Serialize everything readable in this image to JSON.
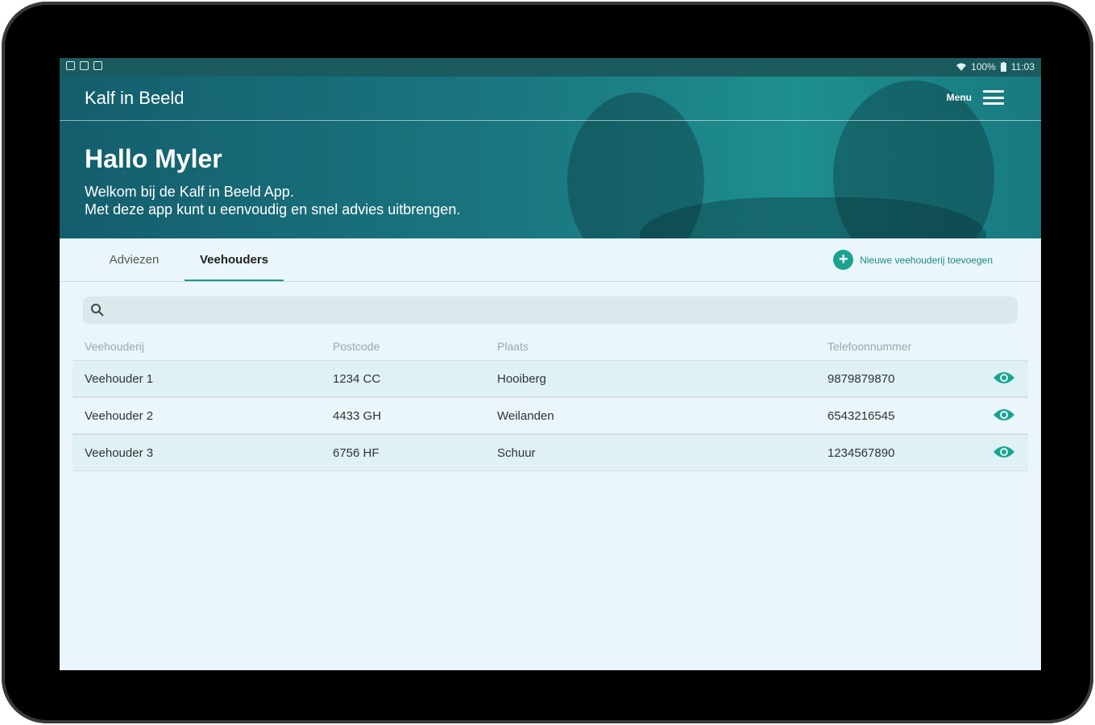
{
  "status_bar": {
    "battery": "100%",
    "time": "11:03",
    "icons": [
      "notification-icon",
      "gallery-icon",
      "clipboard-icon",
      "wifi-icon",
      "battery-icon"
    ]
  },
  "app": {
    "title": "Kalf in Beeld",
    "menu_label": "Menu"
  },
  "hero": {
    "greeting": "Hallo Myler",
    "welcome_line1": "Welkom bij de Kalf in Beeld App.",
    "welcome_line2": "Met deze app kunt u eenvoudig en snel advies uitbrengen."
  },
  "tabs": [
    {
      "label": "Adviezen",
      "active": false
    },
    {
      "label": "Veehouders",
      "active": true
    }
  ],
  "add_button": {
    "label": "Nieuwe veehouderij toevoegen"
  },
  "search": {
    "placeholder": ""
  },
  "table": {
    "columns": [
      "Veehouderij",
      "Postcode",
      "Plaats",
      "Telefoonnummer"
    ],
    "rows": [
      {
        "name": "Veehouder 1",
        "postcode": "1234 CC",
        "plaats": "Hooiberg",
        "telefoon": "9879879870"
      },
      {
        "name": "Veehouder 2",
        "postcode": "4433 GH",
        "plaats": "Weilanden",
        "telefoon": "6543216545"
      },
      {
        "name": "Veehouder 3",
        "postcode": "6756 HF",
        "plaats": "Schuur",
        "telefoon": "1234567890"
      }
    ]
  },
  "colors": {
    "accent": "#1ba392",
    "header_dark": "#145e6d",
    "background": "#eaf6fb"
  }
}
